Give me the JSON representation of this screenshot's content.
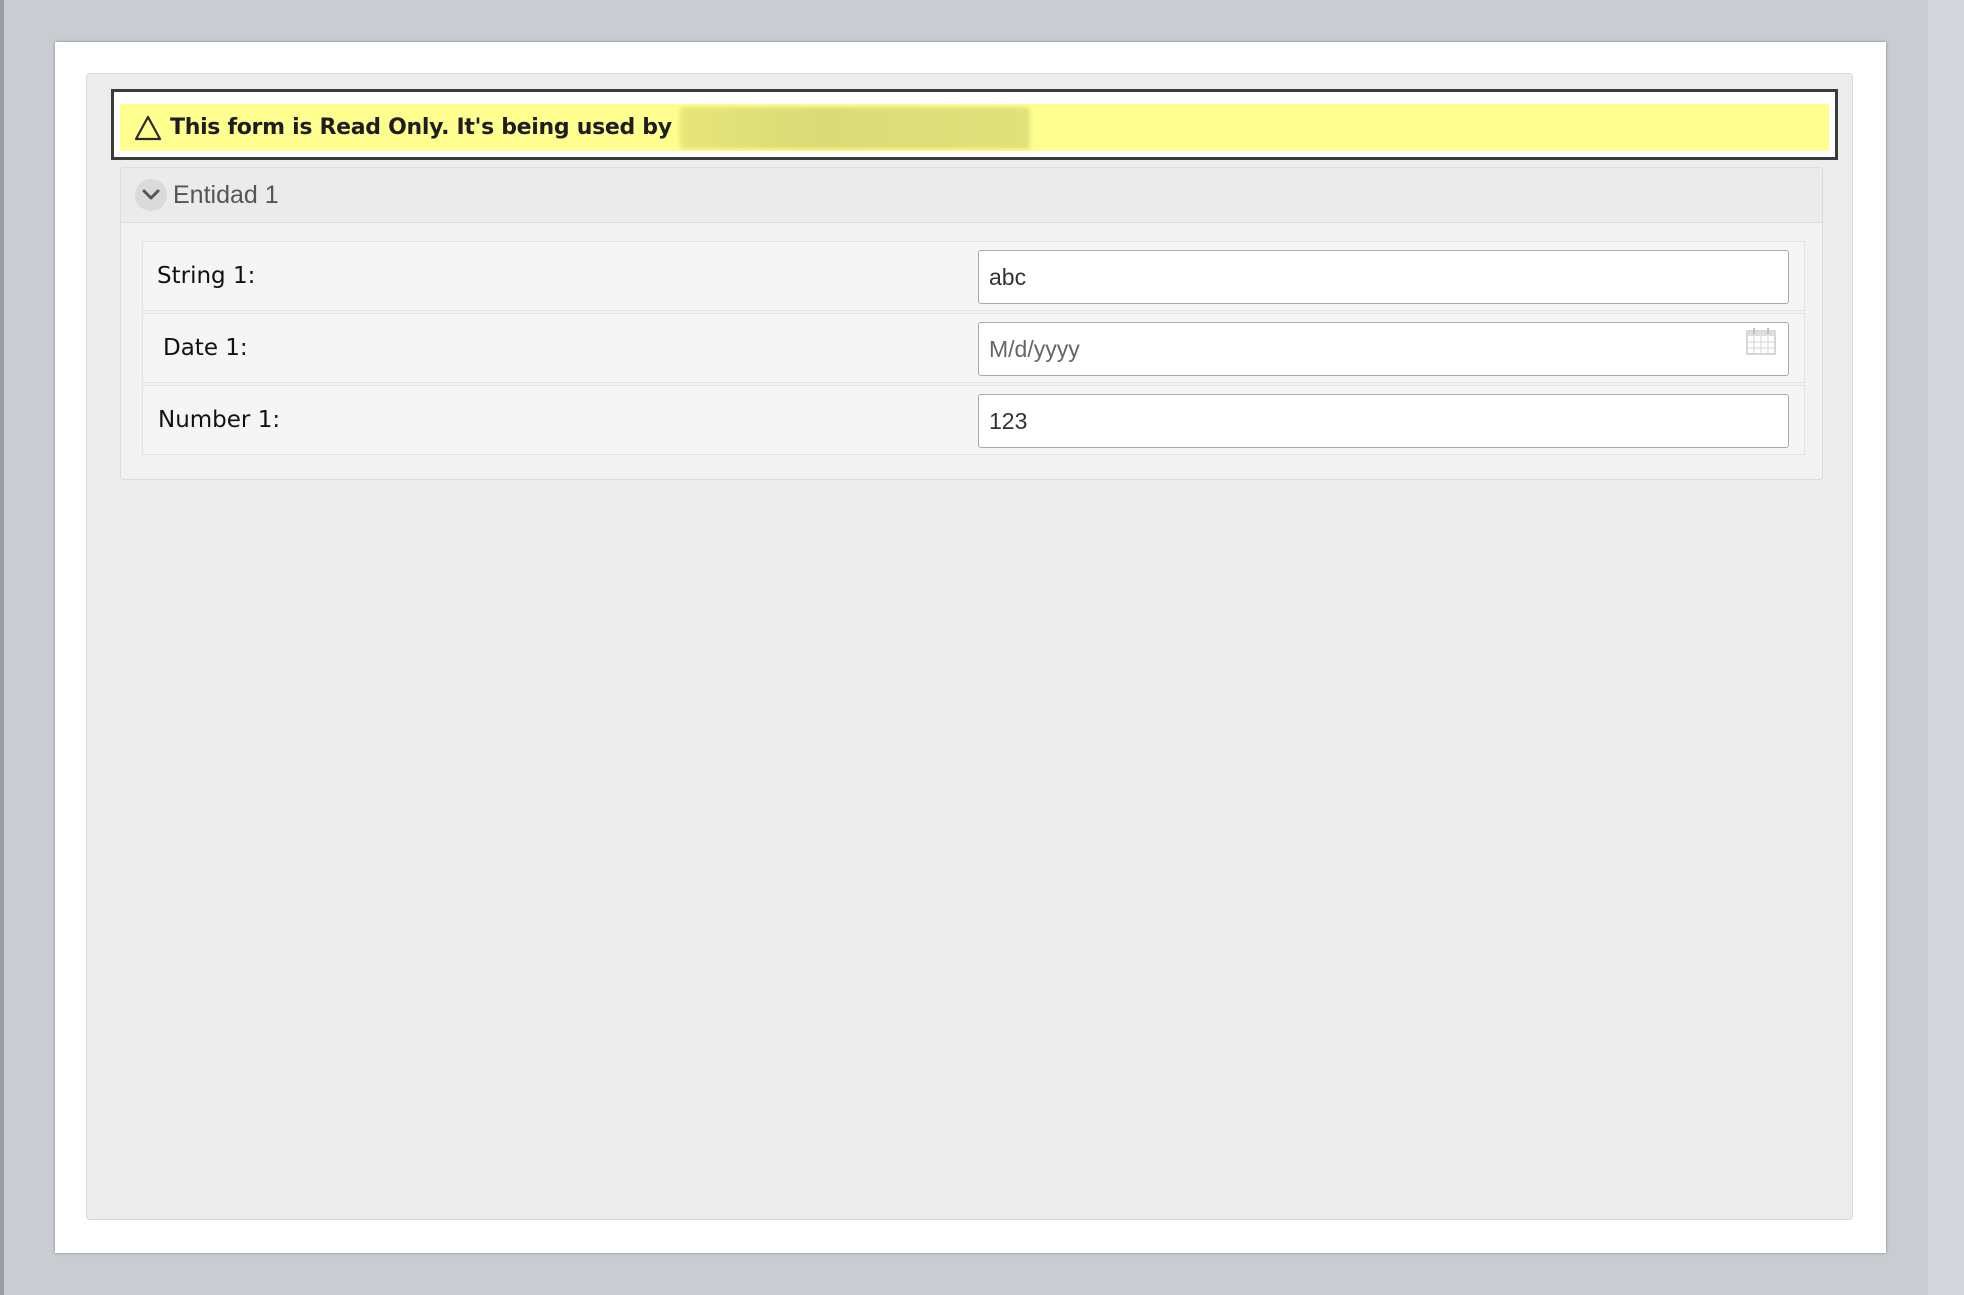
{
  "banner": {
    "icon": "warning-triangle-icon",
    "message": "This form is Read Only. It's being used by",
    "user_obscured": true
  },
  "section": {
    "title": "Entidad 1",
    "collapse_icon": "chevron-down-icon"
  },
  "fields": [
    {
      "label": "String 1:",
      "value": "abc",
      "placeholder": ""
    },
    {
      "label": "Date 1:",
      "value": "",
      "placeholder": "M/d/yyyy",
      "icon": "calendar-icon"
    },
    {
      "label": "Number 1:",
      "value": "123",
      "placeholder": ""
    }
  ]
}
